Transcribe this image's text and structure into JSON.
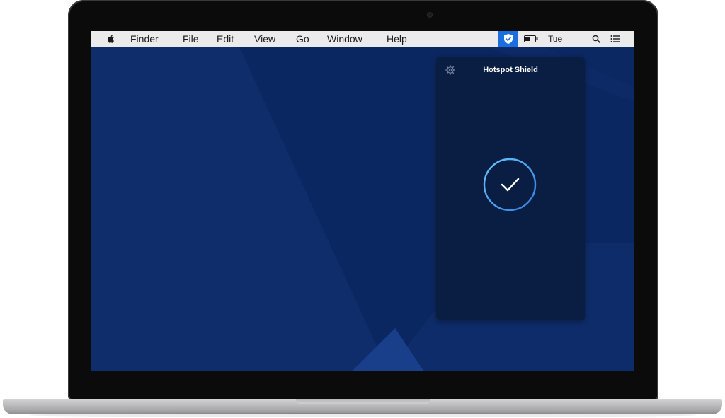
{
  "menubar": {
    "items": [
      {
        "label": "Finder"
      },
      {
        "label": "File"
      },
      {
        "label": "Edit"
      },
      {
        "label": "View"
      },
      {
        "label": "Go"
      },
      {
        "label": "Window"
      },
      {
        "label": "Help"
      }
    ],
    "clock": "Tue",
    "icons": [
      "apple-icon",
      "shield-status-icon",
      "battery-icon",
      "search-icon",
      "list-icon"
    ]
  },
  "panel": {
    "title": "Hotspot Shield",
    "status_icon": "check-icon",
    "settings_icon": "gear-icon"
  },
  "colors": {
    "wallpaper": "#0d2a66",
    "panel": "#0a1d42",
    "accent": "#1a6fe0",
    "ring": "#3fa0f0"
  }
}
